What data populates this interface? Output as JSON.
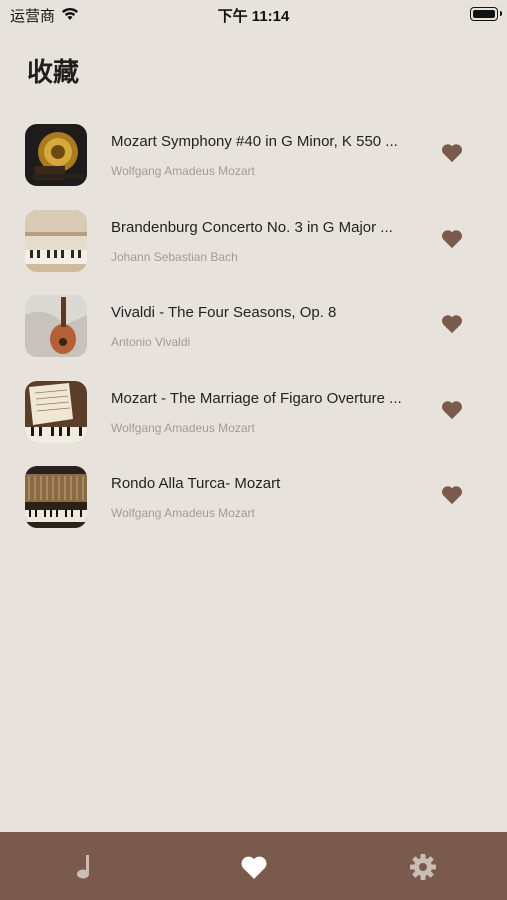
{
  "status_bar": {
    "carrier": "运营商",
    "time": "下午 11:14"
  },
  "page": {
    "title": "收藏"
  },
  "favorites": [
    {
      "title": "Mozart Symphony #40 in G Minor, K 550 ...",
      "artist": "Wolfgang Amadeus Mozart",
      "cover": "gramophone"
    },
    {
      "title": "Brandenburg Concerto No. 3 in G Major ...",
      "artist": "Johann Sebastian Bach",
      "cover": "piano-keys-light"
    },
    {
      "title": "Vivaldi - The Four Seasons, Op. 8",
      "artist": "Antonio Vivaldi",
      "cover": "guitar"
    },
    {
      "title": "Mozart - The Marriage of Figaro Overture ...",
      "artist": "Wolfgang Amadeus Mozart",
      "cover": "sheet-music-piano"
    },
    {
      "title": "Rondo Alla Turca- Mozart",
      "artist": "Wolfgang Amadeus Mozart",
      "cover": "grand-piano-interior"
    }
  ],
  "tab_bar": {
    "tabs": [
      {
        "icon": "music-note-icon",
        "active": false
      },
      {
        "icon": "heart-icon",
        "active": true
      },
      {
        "icon": "gear-icon",
        "active": false
      }
    ]
  },
  "colors": {
    "background": "#e8e2dd",
    "accent": "#7a5a4c",
    "heart": "#7a5a4c",
    "tab_inactive": "#c9bdb6",
    "tab_active": "#ffffff"
  }
}
